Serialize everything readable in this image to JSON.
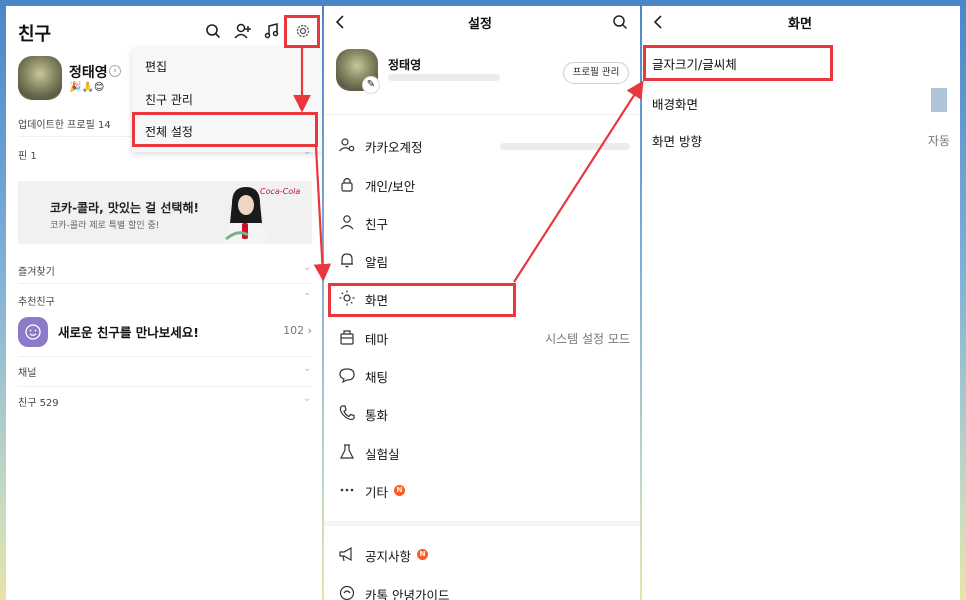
{
  "friends_panel": {
    "title": "친구",
    "profile": {
      "name": "정태영",
      "status_emoji": "🎉🙏😊"
    },
    "dropdown_menu": [
      "편집",
      "친구 관리",
      "전체 설정"
    ],
    "updated_profiles_label": "업데이트한 프로필 14",
    "pin_label": "핀 1",
    "ad": {
      "title": "코카-콜라, 맛있는 걸 선택해!",
      "subtitle": "코카-콜라 제로 특별 할인 중!",
      "brand_logo": "Coca-Cola"
    },
    "favorites_label": "즐겨찾기",
    "recommended_label": "추천친구",
    "recommend_text": "새로운 친구를 만나보세요!",
    "recommend_count": "102",
    "channel_label": "채널",
    "friends_count_label": "친구 529",
    "icons": [
      "search-icon",
      "add-friend-icon",
      "music-icon",
      "gear-icon"
    ]
  },
  "settings_panel": {
    "title": "설정",
    "profile_name": "정태영",
    "profile_manage_button": "프로필 관리",
    "rows": [
      {
        "label": "카카오계정",
        "icon": "account-icon"
      },
      {
        "label": "개인/보안",
        "icon": "lock-icon"
      },
      {
        "label": "친구",
        "icon": "person-icon"
      },
      {
        "label": "알림",
        "icon": "bell-icon"
      },
      {
        "label": "화면",
        "icon": "display-icon"
      },
      {
        "label": "테마",
        "icon": "theme-icon",
        "value": "시스템 설정 모드"
      },
      {
        "label": "채팅",
        "icon": "chat-icon"
      },
      {
        "label": "통화",
        "icon": "phone-icon"
      },
      {
        "label": "실험실",
        "icon": "flask-icon"
      },
      {
        "label": "기타",
        "icon": "more-icon",
        "badge": "N"
      },
      {
        "label": "공지사항",
        "icon": "megaphone-icon",
        "badge": "N"
      },
      {
        "label": "카톡 안녕가이드",
        "icon": "guide-icon"
      }
    ]
  },
  "display_panel": {
    "title": "화면",
    "rows": [
      {
        "label": "글자크기/글씨체"
      },
      {
        "label": "배경화면"
      },
      {
        "label": "화면 방향",
        "value": "자동"
      }
    ]
  },
  "colors": {
    "highlight": "#e8383d",
    "badge": "#ff5a1f",
    "ad_background": "#f1f1f1"
  }
}
